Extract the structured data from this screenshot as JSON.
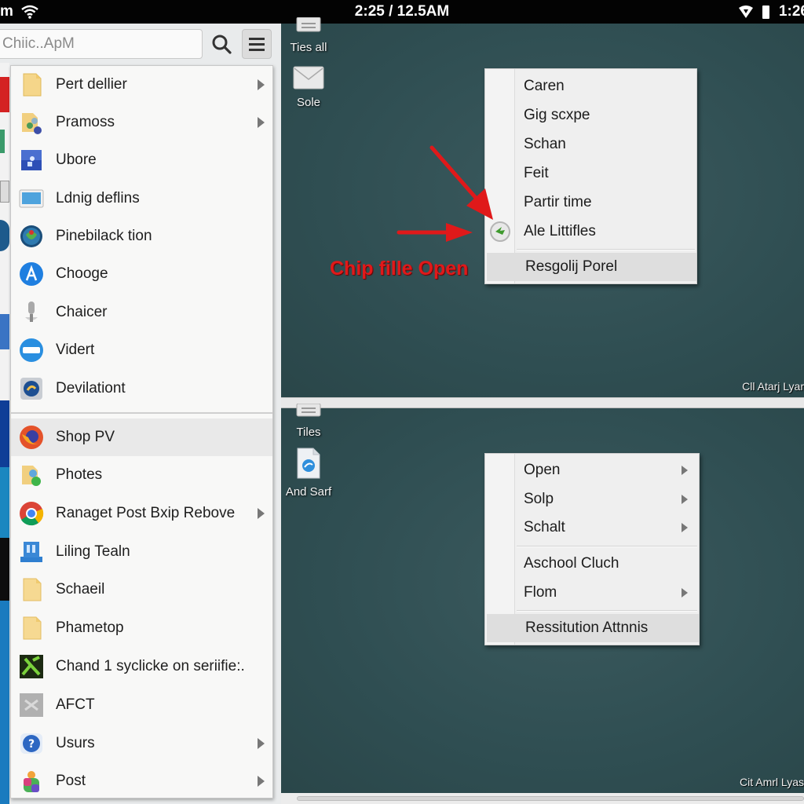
{
  "status_bar": {
    "left_text": "m",
    "clock": "2:25 / 12.5AM",
    "right_time": "1:26",
    "icons": [
      "wifi-icon",
      "signal-icon",
      "battery-icon"
    ]
  },
  "search": {
    "value": "Chiic..ApM",
    "search_icon": "search-icon",
    "menu_icon": "hamburger-menu-icon"
  },
  "app_list": {
    "items": [
      {
        "label": "Pert dellier",
        "icon": "folder-icon",
        "has_submenu": true
      },
      {
        "label": "Pramoss",
        "icon": "folder-network-icon",
        "has_submenu": true
      },
      {
        "label": "Ubore",
        "icon": "blue-square-app-icon",
        "has_submenu": false
      },
      {
        "label": "Ldnig deflins",
        "icon": "monitor-icon",
        "has_submenu": false
      },
      {
        "label": "Pinebilack tion",
        "icon": "globe-app-icon",
        "has_submenu": false
      },
      {
        "label": "Chooge",
        "icon": "app-store-icon",
        "has_submenu": false
      },
      {
        "label": "Chaicer",
        "icon": "microphone-icon",
        "has_submenu": false
      },
      {
        "label": "Vidert",
        "icon": "video-badge-icon",
        "has_submenu": false
      },
      {
        "label": "Devilationt",
        "icon": "globe-settings-icon",
        "has_submenu": false
      },
      {
        "label": "Shop PV",
        "icon": "firefox-icon",
        "has_submenu": false,
        "highlighted": true
      },
      {
        "label": "Photes",
        "icon": "folder-photos-icon",
        "has_submenu": false
      },
      {
        "label": "Ranaget Post Bxip Rebove",
        "icon": "chrome-icon",
        "has_submenu": true
      },
      {
        "label": "Liling Tealn",
        "icon": "blue-building-icon",
        "has_submenu": false
      },
      {
        "label": "Schaeil",
        "icon": "file-icon",
        "has_submenu": false
      },
      {
        "label": "Phametop",
        "icon": "file-icon",
        "has_submenu": false
      },
      {
        "label": "Chand 1 syclicke on seriifie:.",
        "icon": "green-game-icon",
        "has_submenu": false
      },
      {
        "label": "AFCT",
        "icon": "gray-app-icon",
        "has_submenu": false
      },
      {
        "label": "Usurs",
        "icon": "help-icon",
        "has_submenu": true
      },
      {
        "label": "Post",
        "icon": "colorful-bag-icon",
        "has_submenu": true
      }
    ]
  },
  "desktop_top": {
    "icons": [
      {
        "label": "Ties all",
        "icon": "document-tray-icon"
      },
      {
        "label": "Sole",
        "icon": "mail-envelope-icon"
      }
    ],
    "footer": "Cll Atarj Lyar",
    "context_menu": {
      "items": [
        {
          "label": "Caren"
        },
        {
          "label": "Gig scxpe"
        },
        {
          "label": "Schan"
        },
        {
          "label": "Feit"
        },
        {
          "label": "Partir time"
        },
        {
          "label": "Ale Littifles",
          "icon": "green-back-arrow-icon"
        },
        {
          "label": "Resgolij Porel",
          "highlighted": true,
          "separator_before": true
        }
      ]
    },
    "annotation": {
      "text": "Chip fille Open",
      "color": "#e0191a"
    }
  },
  "desktop_bottom": {
    "icons": [
      {
        "label": "Tiles",
        "icon": "document-tray-icon"
      },
      {
        "label": "And Sarf",
        "icon": "file-blue-icon"
      }
    ],
    "footer": "Cit Amrl Lyas",
    "context_menu": {
      "items": [
        {
          "label": "Open",
          "has_submenu": true
        },
        {
          "label": "Solp",
          "has_submenu": true
        },
        {
          "label": "Schalt",
          "has_submenu": true
        },
        {
          "label": "Aschool Cluch",
          "has_submenu": false,
          "separator_before": true
        },
        {
          "label": "Flom",
          "has_submenu": true
        },
        {
          "label": "Ressitution Attnnis",
          "highlighted": true,
          "separator_before": true
        }
      ]
    }
  },
  "colors": {
    "desktop_bg": "#2f4f53",
    "menu_bg": "#efefef",
    "panel_bg": "#f8f8f7",
    "annotation_red": "#e0191a"
  }
}
